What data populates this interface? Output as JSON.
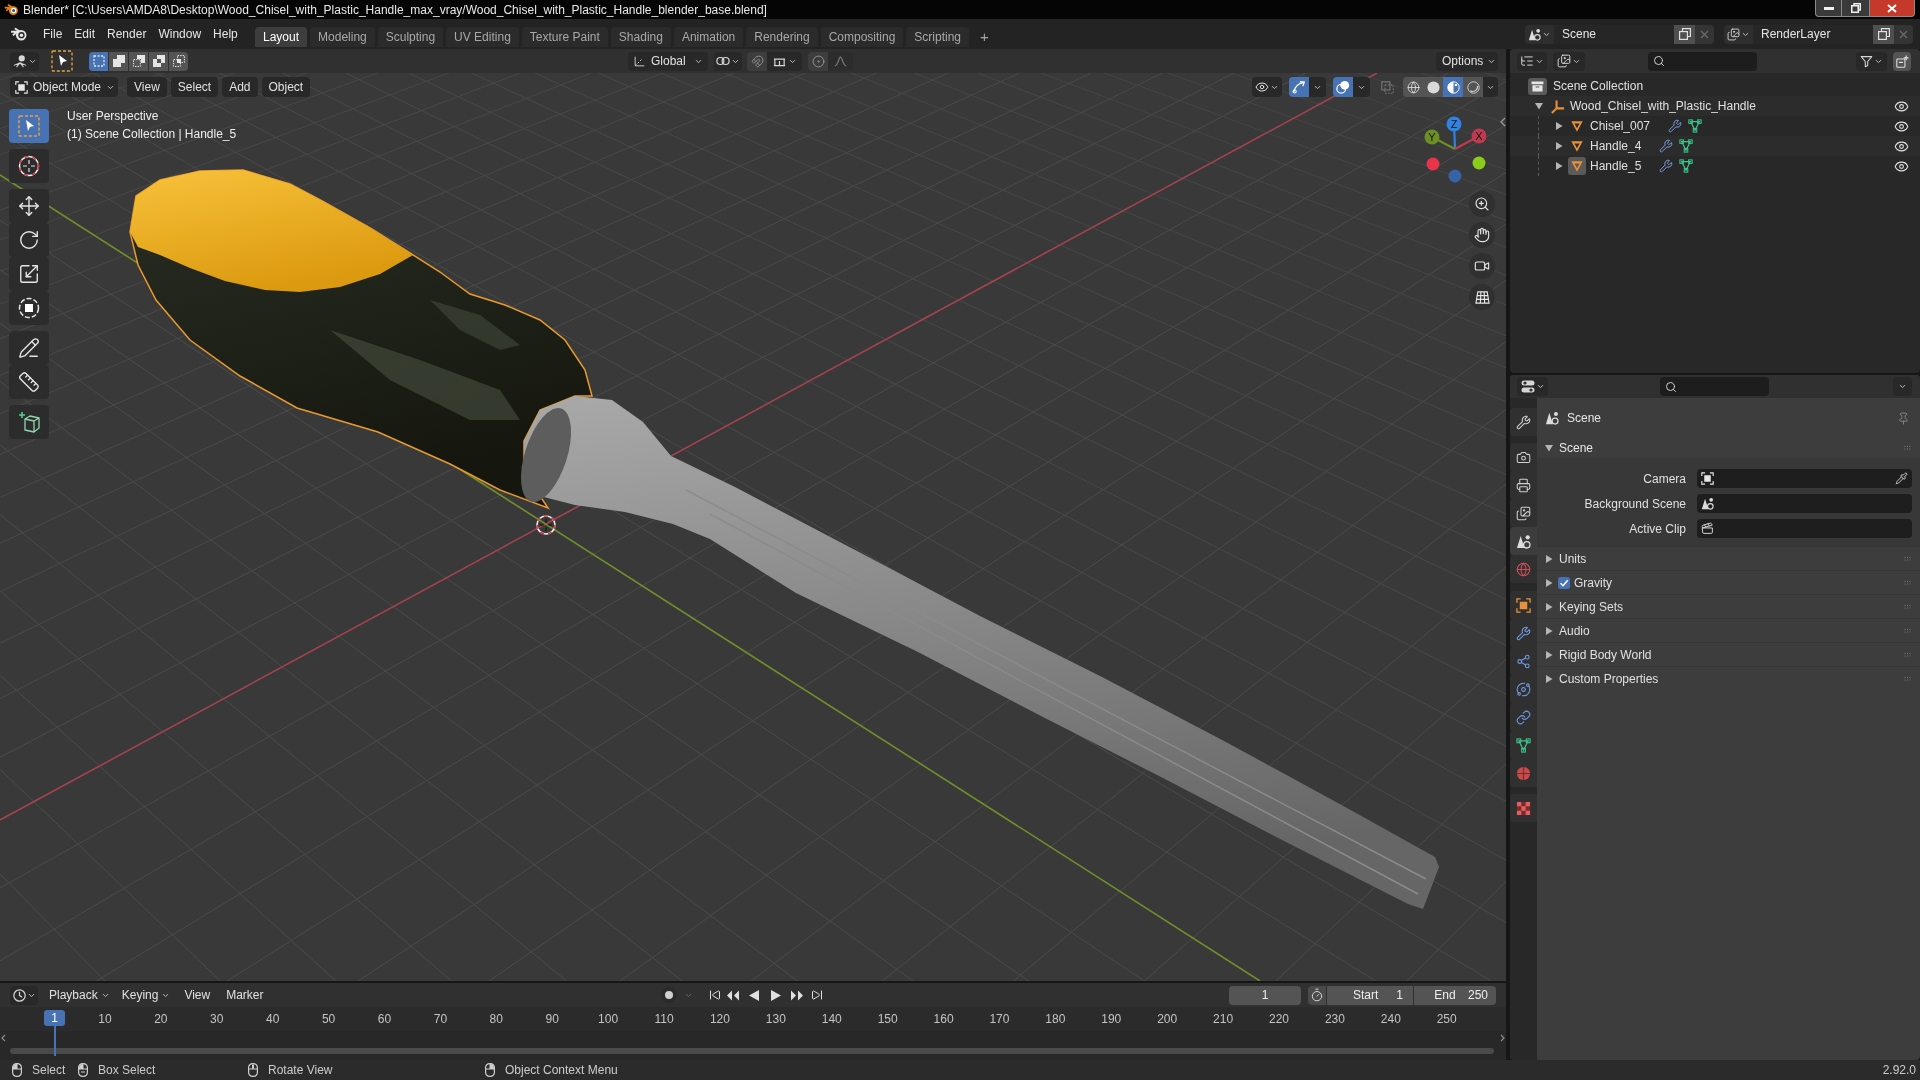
{
  "window": {
    "title": "Blender* [C:\\Users\\AMDA8\\Desktop\\Wood_Chisel_with_Plastic_Handle_max_vray/Wood_Chisel_with_Plastic_Handle_blender_base.blend]"
  },
  "menu": [
    "File",
    "Edit",
    "Render",
    "Window",
    "Help"
  ],
  "workspaces": [
    {
      "label": "Layout",
      "selected": true
    },
    {
      "label": "Modeling",
      "selected": false
    },
    {
      "label": "Sculpting",
      "selected": false
    },
    {
      "label": "UV Editing",
      "selected": false
    },
    {
      "label": "Texture Paint",
      "selected": false
    },
    {
      "label": "Shading",
      "selected": false
    },
    {
      "label": "Animation",
      "selected": false
    },
    {
      "label": "Rendering",
      "selected": false
    },
    {
      "label": "Compositing",
      "selected": false
    },
    {
      "label": "Scripting",
      "selected": false
    }
  ],
  "add_workspace": "+",
  "scene": {
    "value": "Scene"
  },
  "view_layer": {
    "value": "RenderLayer"
  },
  "viewport": {
    "select_modes": [
      {
        "kind": "set",
        "selected": true
      },
      {
        "kind": "extend",
        "selected": false
      },
      {
        "kind": "subtract",
        "selected": false
      },
      {
        "kind": "difference",
        "selected": false
      },
      {
        "kind": "intersect",
        "selected": false
      }
    ],
    "orientation": "Global",
    "options": "Options",
    "mode": "Object Mode",
    "menus": [
      "View",
      "Select",
      "Add",
      "Object"
    ],
    "toggles": [
      {
        "kind": "gizmos",
        "on": true
      },
      {
        "kind": "overlays",
        "on": true
      },
      {
        "kind": "xray",
        "on": false
      }
    ],
    "shading": [
      {
        "kind": "wireframe",
        "selected": false
      },
      {
        "kind": "solid",
        "selected": false
      },
      {
        "kind": "material",
        "selected": true
      },
      {
        "kind": "rendered",
        "selected": false
      }
    ],
    "info": [
      "User Perspective",
      "(1) Scene Collection | Handle_5"
    ],
    "tools": [
      {
        "kind": "select_box",
        "selected": true
      },
      {
        "kind": "cursor",
        "selected": false
      },
      {
        "kind": "move",
        "selected": false
      },
      {
        "kind": "rotate",
        "selected": false
      },
      {
        "kind": "scale",
        "selected": false
      },
      {
        "kind": "transform",
        "selected": false
      },
      {
        "kind": "annotate",
        "selected": false
      },
      {
        "kind": "measure",
        "selected": false
      },
      {
        "kind": "add_cube",
        "selected": false
      }
    ],
    "axes": [
      {
        "label": "Z",
        "color": "#2f83e3"
      },
      {
        "label": "Y",
        "color": "#6b8f24"
      },
      {
        "label": "X",
        "color": "#c03a4f"
      }
    ]
  },
  "outliner": {
    "root": "Scene Collection",
    "items": [
      {
        "label": "Wood_Chisel_with_Plastic_Handle",
        "kind": "empty",
        "expanded": true,
        "active": false,
        "children": [
          {
            "label": "Chisel_007",
            "kind": "mesh",
            "expanded": false,
            "active": false
          },
          {
            "label": "Handle_4",
            "kind": "mesh",
            "expanded": false,
            "active": false
          },
          {
            "label": "Handle_5",
            "kind": "mesh",
            "expanded": false,
            "active": true
          }
        ]
      }
    ]
  },
  "properties": {
    "tabs": [
      {
        "kind": "tool",
        "selected": false
      },
      {
        "kind": "render",
        "selected": false
      },
      {
        "kind": "output",
        "selected": false
      },
      {
        "kind": "view_layer",
        "selected": false
      },
      {
        "kind": "scene",
        "selected": true
      },
      {
        "kind": "world",
        "selected": false
      },
      {
        "kind": "object",
        "selected": false
      },
      {
        "kind": "modifiers",
        "selected": false
      },
      {
        "kind": "particles",
        "selected": false
      },
      {
        "kind": "physics",
        "selected": false
      },
      {
        "kind": "constraints",
        "selected": false
      },
      {
        "kind": "data",
        "selected": false
      },
      {
        "kind": "material",
        "selected": false
      },
      {
        "kind": "texture",
        "selected": false
      }
    ],
    "context": "Scene",
    "panel": {
      "title": "Scene",
      "expanded": true,
      "fields": [
        {
          "label": "Camera",
          "kind": "camera"
        },
        {
          "label": "Background Scene",
          "kind": "scene"
        },
        {
          "label": "Active Clip",
          "kind": "clip"
        }
      ]
    },
    "subpanels": [
      {
        "title": "Units",
        "kind": "plain",
        "expanded": false
      },
      {
        "title": "Gravity",
        "kind": "toggle",
        "checked": true,
        "expanded": false
      },
      {
        "title": "Keying Sets",
        "kind": "plain",
        "expanded": false
      },
      {
        "title": "Audio",
        "kind": "plain",
        "expanded": false
      },
      {
        "title": "Rigid Body World",
        "kind": "plain",
        "expanded": false
      },
      {
        "title": "Custom Properties",
        "kind": "plain",
        "expanded": false
      }
    ]
  },
  "timeline": {
    "menus": [
      {
        "label": "Playback",
        "kind": "dropdown"
      },
      {
        "label": "Keying",
        "kind": "dropdown"
      },
      {
        "label": "View",
        "kind": "plain"
      },
      {
        "label": "Marker",
        "kind": "plain"
      }
    ],
    "auto_keying": false,
    "current_frame": "1",
    "start": {
      "label": "Start",
      "value": "1"
    },
    "end": {
      "label": "End",
      "value": "250"
    },
    "playhead": "1",
    "ruler": [
      "10",
      "20",
      "30",
      "40",
      "50",
      "60",
      "70",
      "80",
      "90",
      "100",
      "110",
      "120",
      "130",
      "140",
      "150",
      "160",
      "170",
      "180",
      "190",
      "200",
      "210",
      "220",
      "230",
      "240",
      "250"
    ]
  },
  "status_bar": {
    "hints": [
      {
        "label": "Select",
        "kind": "left_click"
      },
      {
        "label": "Box Select",
        "kind": "left_drag"
      },
      {
        "label": "Rotate View",
        "kind": "middle_click"
      },
      {
        "label": "Object Context Menu",
        "kind": "right_click"
      }
    ],
    "version": "2.92.0"
  }
}
